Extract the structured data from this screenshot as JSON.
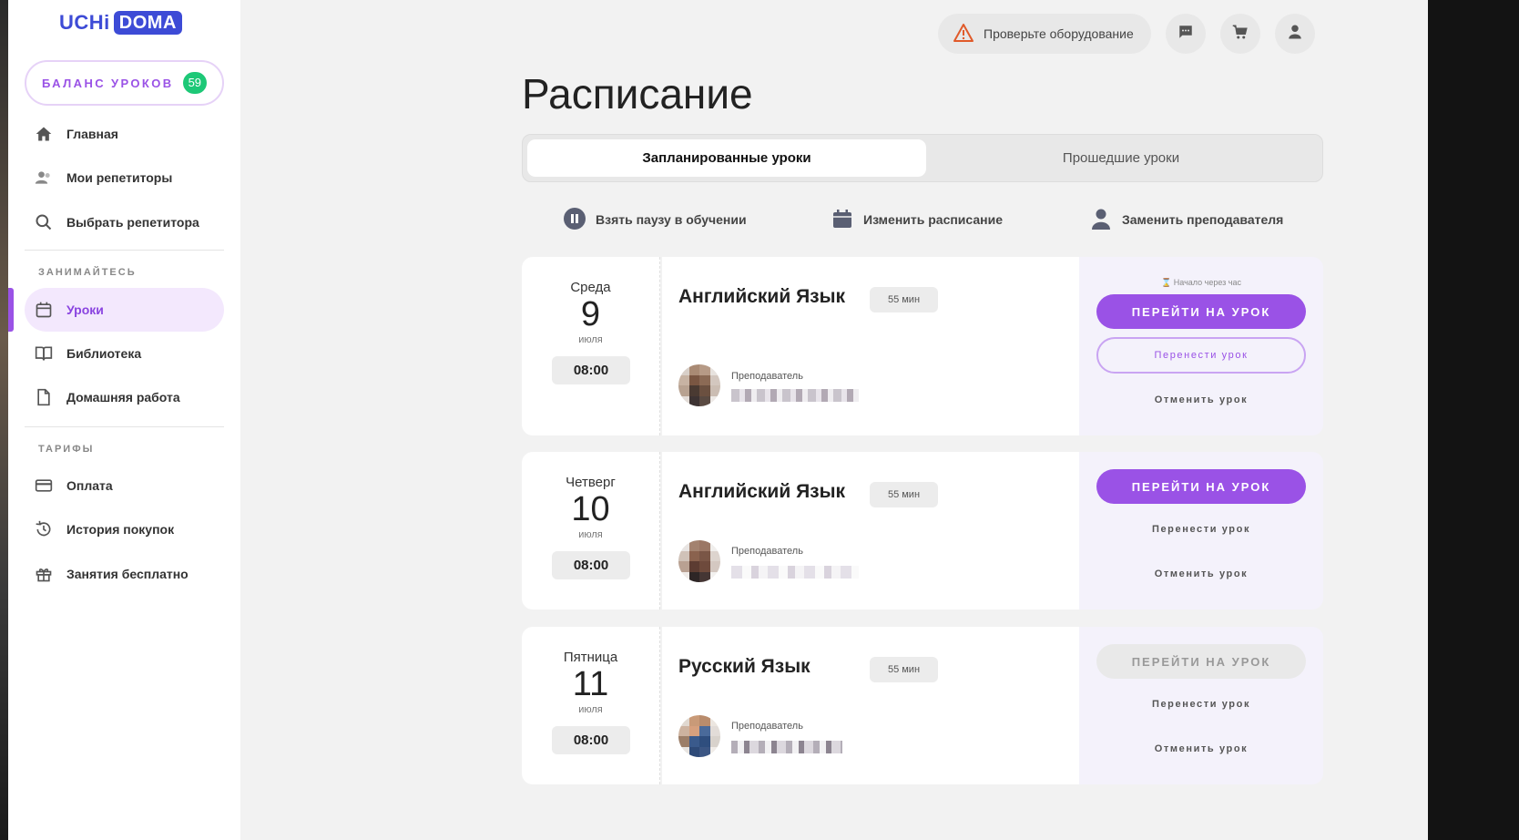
{
  "brand": {
    "part1": "UCHi",
    "part2": "DOMA"
  },
  "balance": {
    "label": "БАЛАНС УРОКОВ",
    "count": "59"
  },
  "nav": {
    "main": "Главная",
    "tutors": "Мои репетиторы",
    "choose_tutor": "Выбрать репетитора",
    "section_study": "ЗАНИМАЙТЕСЬ",
    "lessons": "Уроки",
    "library": "Библиотека",
    "homework": "Домашняя работа",
    "section_tariffs": "ТАРИФЫ",
    "payment": "Оплата",
    "history": "История покупок",
    "free": "Занятия бесплатно"
  },
  "header": {
    "check_equipment": "Проверьте оборудование"
  },
  "page": {
    "title": "Расписание"
  },
  "tabs": {
    "planned": "Запланированные уроки",
    "past": "Прошедшие уроки"
  },
  "actions": {
    "pause": "Взять паузу в обучении",
    "reschedule": "Изменить расписание",
    "replace_teacher": "Заменить преподавателя"
  },
  "lessons": [
    {
      "weekday": "Среда",
      "day": "9",
      "month": "июля",
      "time": "08:00",
      "subject": "Английский Язык",
      "duration": "55 мин",
      "teacher_label": "Преподаватель",
      "starts_in": "Начало через час",
      "go_label": "ПЕРЕЙТИ НА УРОК",
      "go_enabled": true,
      "move_label": "Перенести урок",
      "cancel_label": "Отменить урок"
    },
    {
      "weekday": "Четверг",
      "day": "10",
      "month": "июля",
      "time": "08:00",
      "subject": "Английский Язык",
      "duration": "55 мин",
      "teacher_label": "Преподаватель",
      "go_label": "ПЕРЕЙТИ НА УРОК",
      "go_enabled": true,
      "move_label": "Перенести урок",
      "cancel_label": "Отменить урок"
    },
    {
      "weekday": "Пятница",
      "day": "11",
      "month": "июля",
      "time": "08:00",
      "subject": "Русский Язык",
      "duration": "55 мин",
      "teacher_label": "Преподаватель",
      "go_label": "ПЕРЕЙТИ НА УРОК",
      "go_enabled": false,
      "move_label": "Перенести урок",
      "cancel_label": "Отменить урок"
    }
  ],
  "colors": {
    "accent": "#9a52e6",
    "brand": "#3d4bd6",
    "badge": "#1dc877",
    "warning": "#e05a2a"
  }
}
